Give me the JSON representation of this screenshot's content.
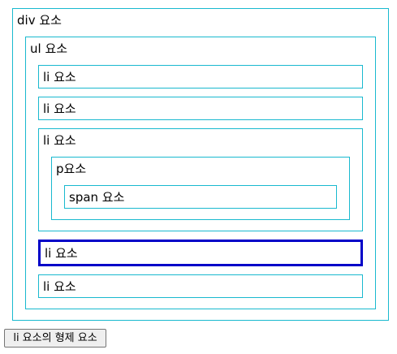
{
  "colors": {
    "border": "#19b9cf",
    "selected_border": "#0000c8"
  },
  "tree": {
    "div": {
      "label": "div 요소"
    },
    "ul": {
      "label": "ul 요소"
    },
    "li_1": {
      "label": "li 요소"
    },
    "li_2": {
      "label": "li 요소"
    },
    "li_3": {
      "label": "li 요소",
      "p": {
        "label": "p요소",
        "span": {
          "label": "span 요소"
        }
      }
    },
    "li_4": {
      "label": "li 요소",
      "selected": true
    },
    "li_5": {
      "label": "li 요소"
    }
  },
  "button": {
    "label": "li 요소의 형제 요소"
  }
}
